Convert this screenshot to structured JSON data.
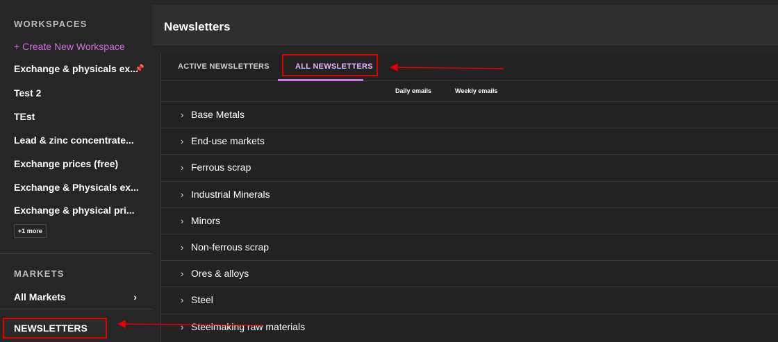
{
  "sidebar": {
    "workspaces_title": "WORKSPACES",
    "create_label": "+ Create New Workspace",
    "workspaces": [
      {
        "label": "Exchange & physicals ex..."
      },
      {
        "label": "Test 2"
      },
      {
        "label": "TEst"
      },
      {
        "label": "Lead & zinc concentrate..."
      },
      {
        "label": "Exchange prices (free)"
      },
      {
        "label": "Exchange & Physicals ex..."
      },
      {
        "label": "Exchange & physical pri..."
      }
    ],
    "more_label": "+1 more",
    "markets_title": "MARKETS",
    "all_markets_label": "All Markets",
    "chevron": "›",
    "newsletters_label": "NEWSLETTERS",
    "pin_icon": "pin-icon"
  },
  "header": {
    "title": "Newsletters"
  },
  "tabs": {
    "active_label": "ACTIVE NEWSLETTERS",
    "all_label": "ALL NEWSLETTERS",
    "daily_label": "Daily emails",
    "weekly_label": "Weekly emails"
  },
  "categories": [
    {
      "label": "Base Metals"
    },
    {
      "label": "End-use markets"
    },
    {
      "label": "Ferrous scrap"
    },
    {
      "label": "Industrial Minerals"
    },
    {
      "label": "Minors"
    },
    {
      "label": "Non-ferrous scrap"
    },
    {
      "label": "Ores & alloys"
    },
    {
      "label": "Steel"
    },
    {
      "label": "Steelmaking raw materials"
    }
  ],
  "colors": {
    "accent": "#c47be3",
    "annotation": "#e00000",
    "background": "#262626"
  }
}
